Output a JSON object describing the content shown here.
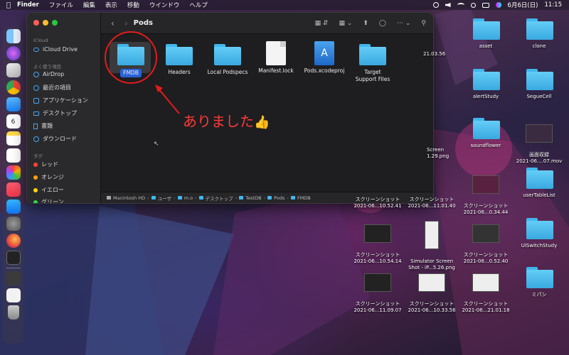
{
  "menubar": {
    "app": "Finder",
    "menus": [
      "ファイル",
      "編集",
      "表示",
      "移動",
      "ウインドウ",
      "ヘルプ"
    ],
    "date": "6月6日(日)",
    "time": "11:15"
  },
  "window": {
    "title": "Pods",
    "sidebar": {
      "section_icloud": "iCloud",
      "icloud_drive": "iCloud Drive",
      "section_favorites": "よく使う項目",
      "favorites": [
        "AirDrop",
        "最近の項目",
        "アプリケーション",
        "デスクトップ",
        "書類",
        "ダウンロード"
      ],
      "section_tags": "タグ",
      "tags": [
        {
          "label": "レッド",
          "color": "#ff453a"
        },
        {
          "label": "オレンジ",
          "color": "#ff9f0a"
        },
        {
          "label": "イエロー",
          "color": "#ffd60a"
        },
        {
          "label": "グリーン",
          "color": "#32d74b"
        }
      ]
    },
    "files": [
      {
        "name": "FMDB",
        "kind": "folder",
        "selected": true
      },
      {
        "name": "Headers",
        "kind": "folder"
      },
      {
        "name": "Local Podspecs",
        "kind": "folder"
      },
      {
        "name": "Manifest.lock",
        "kind": "document"
      },
      {
        "name": "Pods.xcodeproj",
        "kind": "xcodeproj"
      },
      {
        "name": "Target Support Files",
        "kind": "folder"
      }
    ],
    "path": [
      "Macintosh HD",
      "ユーザ",
      "m.o",
      "デスクトップ",
      "TestDB",
      "Pods",
      "FMDB"
    ]
  },
  "annotation": {
    "text": "ありました",
    "emoji": "👍"
  },
  "desktop": {
    "items": [
      {
        "label": "asset",
        "kind": "folder"
      },
      {
        "label": "clone",
        "kind": "folder"
      },
      {
        "label": "alertStudy",
        "kind": "folder"
      },
      {
        "label": "SegueCell",
        "kind": "folder"
      },
      {
        "label": "soundflower",
        "kind": "folder"
      },
      {
        "label": "画面収録\n2021-06....07.mov",
        "kind": "video"
      },
      {
        "label": "userTableList",
        "kind": "folder"
      },
      {
        "label": "スクリーンショット\n2021-06...10.52.41",
        "kind": "shot"
      },
      {
        "label": "スクリーンショット\n2021-06...11.01.40",
        "kind": "shot"
      },
      {
        "label": "スクリーンショット\n2021-06...0.34.44",
        "kind": "shot"
      },
      {
        "label": "スクリーンショット\n2021-06...10.54.14",
        "kind": "shot"
      },
      {
        "label": "Simulator Screen\nShot - iP...5.26.png",
        "kind": "shot-light"
      },
      {
        "label": "スクリーンショット\n2021-06...0.52.40",
        "kind": "shot"
      },
      {
        "label": "UISwitchStudy",
        "kind": "folder"
      },
      {
        "label": "スクリーンショット\n2021-06...11.09.07",
        "kind": "shot"
      },
      {
        "label": "スクリーンショット\n2021-06...10.33.56",
        "kind": "shot-light"
      },
      {
        "label": "スクリーンショット\n2021-06...21.01.18",
        "kind": "shot-light"
      },
      {
        "label": "ミパシ",
        "kind": "folder"
      }
    ],
    "partial_labels": [
      "21.03.56",
      "Screen",
      "1.29.png"
    ]
  }
}
